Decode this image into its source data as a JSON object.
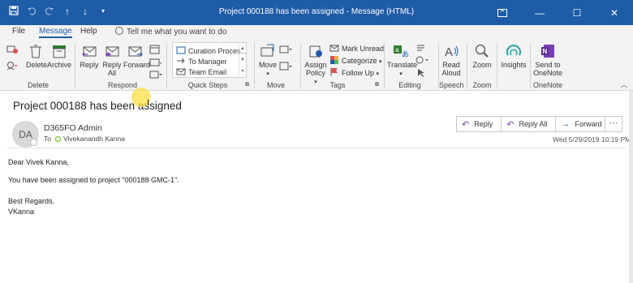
{
  "window": {
    "title": "Project 000188 has been assigned  -  Message (HTML)",
    "controls": {
      "restore": "▭",
      "minimize": "—",
      "maximize": "☐",
      "close": "✕"
    }
  },
  "quick_access": {
    "save": "💾",
    "undo": "↶",
    "redo": "↷",
    "up": "↑",
    "down": "↓",
    "customize": "▾"
  },
  "tabs": [
    {
      "label": "File"
    },
    {
      "label": "Message"
    },
    {
      "label": "Help"
    }
  ],
  "tell_me": "Tell me what you want to do",
  "ribbon": {
    "delete": {
      "label": "Delete",
      "buttons": {
        "delete": "Delete",
        "archive": "Archive"
      }
    },
    "respond": {
      "label": "Respond",
      "buttons": {
        "reply": "Reply",
        "reply_all_1": "Reply",
        "reply_all_2": "All",
        "forward": "Forward"
      }
    },
    "quick_steps": {
      "label": "Quick Steps",
      "items": [
        "Curation Proces...",
        "To Manager",
        "Team Email"
      ]
    },
    "move": {
      "label": "Move",
      "buttons": {
        "move": "Move"
      }
    },
    "tags": {
      "label": "Tags",
      "buttons": {
        "assign_1": "Assign",
        "assign_2": "Policy",
        "mark_unread": "Mark Unread",
        "categorize": "Categorize",
        "follow_up": "Follow Up"
      }
    },
    "editing": {
      "label": "Editing",
      "buttons": {
        "translate": "Translate"
      }
    },
    "speech": {
      "label": "Speech",
      "buttons": {
        "read_1": "Read",
        "read_2": "Aloud"
      }
    },
    "zoom": {
      "label": "Zoom",
      "buttons": {
        "zoom": "Zoom"
      }
    },
    "insights": {
      "buttons": {
        "insights": "Insights"
      }
    },
    "onenote": {
      "label": "OneNote",
      "buttons": {
        "send_1": "Send to",
        "send_2": "OneNote"
      }
    }
  },
  "message": {
    "subject": "Project 000188 has been assigned",
    "avatar_initials": "DA",
    "sender": "D365FO Admin",
    "to_label": "To",
    "recipient": "Vivekanandh Kanna",
    "date": "Wed 5/29/2019 10:19 PM",
    "actions": {
      "reply": "Reply",
      "reply_all": "Reply All",
      "forward": "Forward",
      "more": "···"
    },
    "body": {
      "greeting": "Dear Vivek Kanna,",
      "line1": "You have been assigned to project \"000188 GMC-1\".",
      "closing": "Best Regards,",
      "signature": "VKanna"
    }
  },
  "colors": {
    "accent": "#1f5ca7",
    "ribbon_bg": "#f3f3f3",
    "presence": "#6bb700"
  }
}
